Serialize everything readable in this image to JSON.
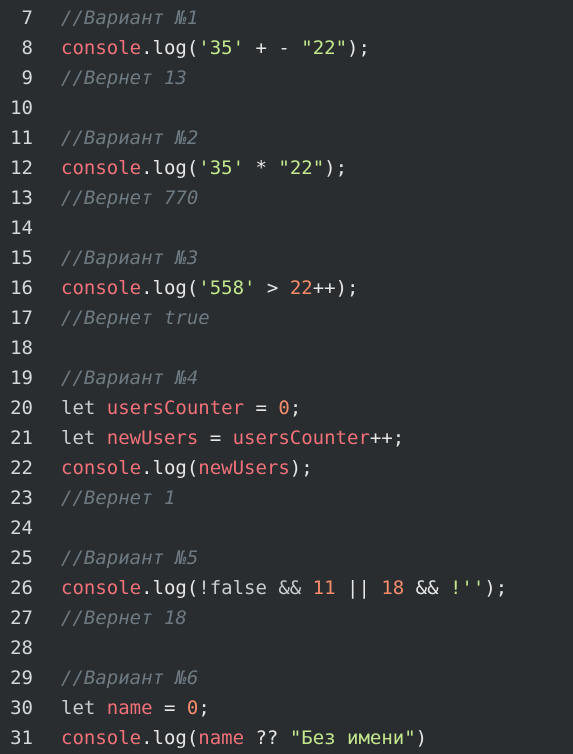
{
  "lines": [
    {
      "n": "7",
      "tokens": [
        {
          "t": "//Вариант №1",
          "c": "comment"
        }
      ]
    },
    {
      "n": "8",
      "tokens": [
        {
          "t": "console",
          "c": "fn"
        },
        {
          "t": ".log(",
          "c": "plain"
        },
        {
          "t": "'35'",
          "c": "str"
        },
        {
          "t": " + - ",
          "c": "op"
        },
        {
          "t": "\"22\"",
          "c": "str"
        },
        {
          "t": ");",
          "c": "plain"
        }
      ]
    },
    {
      "n": "9",
      "tokens": [
        {
          "t": "//Вернет 13",
          "c": "comment"
        }
      ]
    },
    {
      "n": "10",
      "tokens": []
    },
    {
      "n": "11",
      "tokens": [
        {
          "t": "//Вариант №2",
          "c": "comment"
        }
      ]
    },
    {
      "n": "12",
      "tokens": [
        {
          "t": "console",
          "c": "fn"
        },
        {
          "t": ".log(",
          "c": "plain"
        },
        {
          "t": "'35'",
          "c": "str"
        },
        {
          "t": " * ",
          "c": "op"
        },
        {
          "t": "\"22\"",
          "c": "str"
        },
        {
          "t": ");",
          "c": "plain"
        }
      ]
    },
    {
      "n": "13",
      "tokens": [
        {
          "t": "//Вернет 770",
          "c": "comment"
        }
      ]
    },
    {
      "n": "14",
      "tokens": []
    },
    {
      "n": "15",
      "tokens": [
        {
          "t": "//Вариант №3",
          "c": "comment"
        }
      ]
    },
    {
      "n": "16",
      "tokens": [
        {
          "t": "console",
          "c": "fn"
        },
        {
          "t": ".log(",
          "c": "plain"
        },
        {
          "t": "'558'",
          "c": "str"
        },
        {
          "t": " > ",
          "c": "op"
        },
        {
          "t": "22",
          "c": "num"
        },
        {
          "t": "++);",
          "c": "plain"
        }
      ]
    },
    {
      "n": "17",
      "tokens": [
        {
          "t": "//Вернет true",
          "c": "comment"
        }
      ]
    },
    {
      "n": "18",
      "tokens": []
    },
    {
      "n": "19",
      "tokens": [
        {
          "t": "//Вариант №4",
          "c": "comment"
        }
      ]
    },
    {
      "n": "20",
      "tokens": [
        {
          "t": "let ",
          "c": "kw"
        },
        {
          "t": "usersCounter",
          "c": "var"
        },
        {
          "t": " = ",
          "c": "op"
        },
        {
          "t": "0",
          "c": "num"
        },
        {
          "t": ";",
          "c": "plain"
        }
      ]
    },
    {
      "n": "21",
      "tokens": [
        {
          "t": "let ",
          "c": "kw"
        },
        {
          "t": "newUsers",
          "c": "var"
        },
        {
          "t": " = ",
          "c": "op"
        },
        {
          "t": "usersCounter",
          "c": "var"
        },
        {
          "t": "++;",
          "c": "plain"
        }
      ]
    },
    {
      "n": "22",
      "tokens": [
        {
          "t": "console",
          "c": "fn"
        },
        {
          "t": ".log(",
          "c": "plain"
        },
        {
          "t": "newUsers",
          "c": "var"
        },
        {
          "t": ");",
          "c": "plain"
        }
      ]
    },
    {
      "n": "23",
      "tokens": [
        {
          "t": "//Вернет 1",
          "c": "comment"
        }
      ]
    },
    {
      "n": "24",
      "tokens": []
    },
    {
      "n": "25",
      "tokens": [
        {
          "t": "//Вариант №5",
          "c": "comment"
        }
      ]
    },
    {
      "n": "26",
      "tokens": [
        {
          "t": "console",
          "c": "fn"
        },
        {
          "t": ".log(",
          "c": "plain"
        },
        {
          "t": "!false && ",
          "c": "kw"
        },
        {
          "t": "11",
          "c": "num"
        },
        {
          "t": " || ",
          "c": "op"
        },
        {
          "t": "18",
          "c": "num"
        },
        {
          "t": " && ",
          "c": "op"
        },
        {
          "t": "!''",
          "c": "str"
        },
        {
          "t": ");",
          "c": "plain"
        }
      ]
    },
    {
      "n": "27",
      "tokens": [
        {
          "t": "//Вернет 18",
          "c": "comment"
        }
      ]
    },
    {
      "n": "28",
      "tokens": []
    },
    {
      "n": "29",
      "tokens": [
        {
          "t": "//Вариант №6",
          "c": "comment"
        }
      ]
    },
    {
      "n": "30",
      "tokens": [
        {
          "t": "let ",
          "c": "kw"
        },
        {
          "t": "name",
          "c": "var"
        },
        {
          "t": " = ",
          "c": "op"
        },
        {
          "t": "0",
          "c": "num"
        },
        {
          "t": ";",
          "c": "plain"
        }
      ]
    },
    {
      "n": "31",
      "tokens": [
        {
          "t": "console",
          "c": "fn"
        },
        {
          "t": ".log(",
          "c": "plain"
        },
        {
          "t": "name",
          "c": "var"
        },
        {
          "t": " ?? ",
          "c": "op"
        },
        {
          "t": "\"Без имени\"",
          "c": "str"
        },
        {
          "t": ")",
          "c": "plain"
        }
      ]
    }
  ]
}
